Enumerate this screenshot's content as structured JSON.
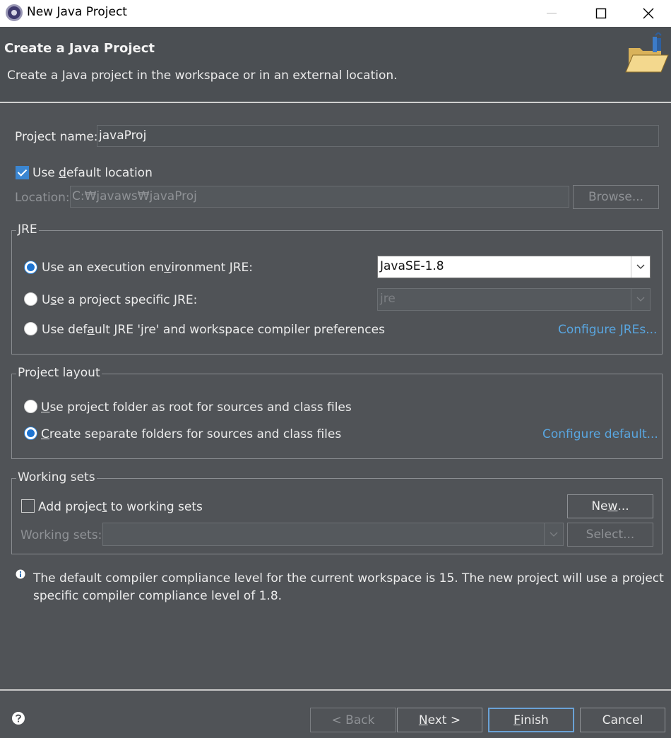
{
  "window": {
    "title": "New Java Project"
  },
  "header": {
    "title": "Create a Java Project",
    "description": "Create a Java project in the workspace or in an external location."
  },
  "project": {
    "name_label": "Project name:",
    "name_value": "javaProj"
  },
  "location": {
    "use_default_pre": "Use ",
    "use_default_u": "d",
    "use_default_post": "efault location",
    "use_default_checked": true,
    "label": "Location:",
    "value": "C:₩javaws₩javaProj",
    "browse": "Browse..."
  },
  "jre": {
    "group_title": "JRE",
    "option1_pre": "Use an execution en",
    "option1_u": "v",
    "option1_post": "ironment JRE:",
    "option1_value": "JavaSE-1.8",
    "option2_pre": "U",
    "option2_u": "s",
    "option2_post": "e a project specific JRE:",
    "option2_value": "jre",
    "option3_pre": "Use def",
    "option3_u": "a",
    "option3_post": "ult JRE 'jre' and workspace compiler preferences",
    "configure_link": "Configure JREs..."
  },
  "layout": {
    "group_title": "Project layout",
    "option1_u": "U",
    "option1_post": "se project folder as root for sources and class files",
    "option2_u": "C",
    "option2_post": "reate separate folders for sources and class files",
    "configure_link": "Configure default..."
  },
  "working_sets": {
    "group_title": "Working sets",
    "add_pre": "Add projec",
    "add_u": "t",
    "add_post": " to working sets",
    "add_checked": false,
    "new_pre": "Ne",
    "new_u": "w",
    "new_post": "...",
    "label": "Working sets:",
    "select": "Select..."
  },
  "info": {
    "line1": "The default compiler compliance level for the current workspace is 15. The new project will use a project",
    "line2": "specific compiler compliance level of 1.8."
  },
  "footer": {
    "back": "< Back",
    "next_u": "N",
    "next_post": "ext >",
    "finish_u": "F",
    "finish_post": "inish",
    "cancel": "Cancel"
  },
  "colors": {
    "link": "#59a6e0",
    "accent": "#1d74d2",
    "background": "#505357"
  }
}
